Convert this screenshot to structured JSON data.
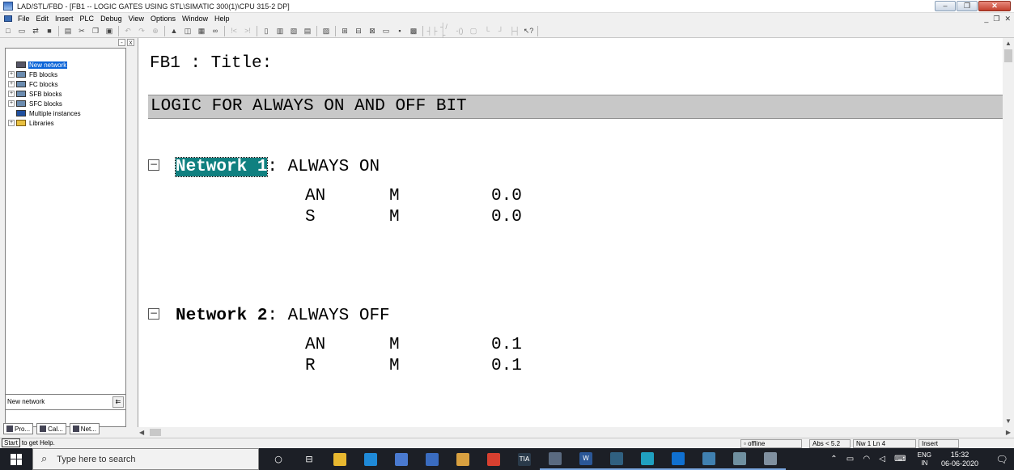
{
  "window": {
    "title": "LAD/STL/FBD  - [FB1 -- LOGIC GATES USING STL\\SIMATIC 300(1)\\CPU 315-2 DP]"
  },
  "menu": [
    "File",
    "Edit",
    "Insert",
    "PLC",
    "Debug",
    "View",
    "Options",
    "Window",
    "Help"
  ],
  "toolbar": {
    "buttons": [
      {
        "name": "new-icon",
        "glyph": "□",
        "dim": false
      },
      {
        "name": "open-icon",
        "glyph": "▭",
        "dim": false
      },
      {
        "name": "accessible-nodes-icon",
        "glyph": "⇄",
        "dim": false
      },
      {
        "name": "save-icon",
        "glyph": "■",
        "dim": false
      },
      {
        "name": "print-icon",
        "glyph": "▤",
        "dim": false
      },
      {
        "name": "cut-icon",
        "glyph": "✂",
        "dim": false
      },
      {
        "name": "copy-icon",
        "glyph": "❐",
        "dim": false
      },
      {
        "name": "paste-icon",
        "glyph": "▣",
        "dim": false
      },
      {
        "name": "undo-icon",
        "glyph": "↶",
        "dim": true
      },
      {
        "name": "redo-icon",
        "glyph": "↷",
        "dim": true
      },
      {
        "name": "compare-icon",
        "glyph": "⊕",
        "dim": true
      },
      {
        "name": "download-icon",
        "glyph": "▲",
        "dim": false
      },
      {
        "name": "monitor-icon",
        "glyph": "◫",
        "dim": false
      },
      {
        "name": "module-info-icon",
        "glyph": "▦",
        "dim": false
      },
      {
        "name": "glasses-icon",
        "glyph": "∞",
        "dim": false
      },
      {
        "name": "prev-network-icon",
        "glyph": "!<",
        "dim": true
      },
      {
        "name": "next-network-icon",
        "glyph": ">!",
        "dim": true
      },
      {
        "name": "overview-icon",
        "glyph": "▯",
        "dim": false
      },
      {
        "name": "details-icon",
        "glyph": "▥",
        "dim": false
      },
      {
        "name": "ladder-view-icon",
        "glyph": "▧",
        "dim": false
      },
      {
        "name": "stl-view-icon",
        "glyph": "▤",
        "dim": false
      },
      {
        "name": "fbd-view-icon",
        "glyph": "▨",
        "dim": false
      },
      {
        "name": "new-network-icon",
        "glyph": "⊞",
        "dim": false
      },
      {
        "name": "program-elements-icon",
        "glyph": "⊟",
        "dim": false
      },
      {
        "name": "call-structure-icon",
        "glyph": "⊠",
        "dim": false
      },
      {
        "name": "symbol-info-icon",
        "glyph": "▭",
        "dim": false
      },
      {
        "name": "addresses-icon",
        "glyph": "▪",
        "dim": false
      },
      {
        "name": "modify-icon",
        "glyph": "▩",
        "dim": false
      },
      {
        "name": "contact-no-icon",
        "glyph": "┤├",
        "dim": true
      },
      {
        "name": "contact-nc-icon",
        "glyph": "┤/├",
        "dim": true
      },
      {
        "name": "coil-icon",
        "glyph": "-()",
        "dim": true
      },
      {
        "name": "box-icon",
        "glyph": "▢",
        "dim": true
      },
      {
        "name": "branch-open-icon",
        "glyph": "└",
        "dim": true
      },
      {
        "name": "branch-close-icon",
        "glyph": "┘",
        "dim": true
      },
      {
        "name": "connection-icon",
        "glyph": "├┤",
        "dim": true
      },
      {
        "name": "help-pointer-icon",
        "glyph": "↖?",
        "dim": false
      }
    ]
  },
  "tree": {
    "items": [
      {
        "label": "New network",
        "expander": "",
        "icon": "net",
        "selected": true
      },
      {
        "label": "FB blocks",
        "expander": "+",
        "icon": "block",
        "selected": false
      },
      {
        "label": "FC blocks",
        "expander": "+",
        "icon": "block",
        "selected": false
      },
      {
        "label": "SFB blocks",
        "expander": "+",
        "icon": "block",
        "selected": false
      },
      {
        "label": "SFC blocks",
        "expander": "+",
        "icon": "block",
        "selected": false
      },
      {
        "label": "Multiple instances",
        "expander": "",
        "icon": "multi",
        "selected": false
      },
      {
        "label": "Libraries",
        "expander": "+",
        "icon": "lib",
        "selected": false
      }
    ],
    "status_text": "New network",
    "tabs": [
      "Pro...",
      "Cal...",
      "Net..."
    ]
  },
  "editor": {
    "block_title": "FB1 : Title:",
    "block_comment": "LOGIC FOR ALWAYS ON AND OFF BIT",
    "networks": [
      {
        "label": "Network 1",
        "title": ": ALWAYS ON",
        "selected": true,
        "lines": [
          {
            "op": "AN",
            "addr": "M",
            "val": "0.0"
          },
          {
            "op": "S",
            "addr": "M",
            "val": "0.0"
          }
        ]
      },
      {
        "label": "Network 2",
        "title": ": ALWAYS OFF",
        "selected": false,
        "lines": [
          {
            "op": "AN",
            "addr": "M",
            "val": "0.1"
          },
          {
            "op": "R",
            "addr": "M",
            "val": "0.1"
          }
        ]
      }
    ]
  },
  "statusbar": {
    "tooltip": "Start",
    "help_text": "to get Help.",
    "mode": "offline",
    "abs": "Abs < 5.2",
    "position": "Nw 1 Ln 4",
    "insert": "Insert"
  },
  "taskbar": {
    "search_placeholder": "Type here to search",
    "apps": [
      {
        "name": "cortana-icon",
        "glyph": "○",
        "color": ""
      },
      {
        "name": "task-view-icon",
        "glyph": "⊟",
        "color": ""
      },
      {
        "name": "file-explorer-icon",
        "glyph": "",
        "color": "#e8b830"
      },
      {
        "name": "edge-icon",
        "glyph": "",
        "color": "#1f8ad8"
      },
      {
        "name": "store-icon",
        "glyph": "",
        "color": "#4a7ad0"
      },
      {
        "name": "mail-icon",
        "glyph": "",
        "color": "#3a6cc0"
      },
      {
        "name": "paint-icon",
        "glyph": "",
        "color": "#d8a040"
      },
      {
        "name": "chrome-icon",
        "glyph": "",
        "color": "#d84030"
      },
      {
        "name": "tia-portal-icon",
        "glyph": "TIA",
        "color": "#2a3a4a"
      },
      {
        "name": "simatic-manager-icon",
        "glyph": "",
        "color": "#5a6a80"
      },
      {
        "name": "word-icon",
        "glyph": "W",
        "color": "#2b5797"
      },
      {
        "name": "screen-icon",
        "glyph": "",
        "color": "#306080"
      },
      {
        "name": "shape-icon",
        "glyph": "",
        "color": "#20a0c0"
      },
      {
        "name": "teamviewer-icon",
        "glyph": "",
        "color": "#1070d0"
      },
      {
        "name": "plcsim-icon",
        "glyph": "",
        "color": "#4080b0"
      },
      {
        "name": "netpro-icon",
        "glyph": "",
        "color": "#7090a0"
      },
      {
        "name": "lad-stl-fbd-icon",
        "glyph": "",
        "color": "#8090a0"
      }
    ],
    "lang_top": "ENG",
    "lang_bottom": "IN",
    "time": "15:32",
    "date": "06-06-2020"
  }
}
